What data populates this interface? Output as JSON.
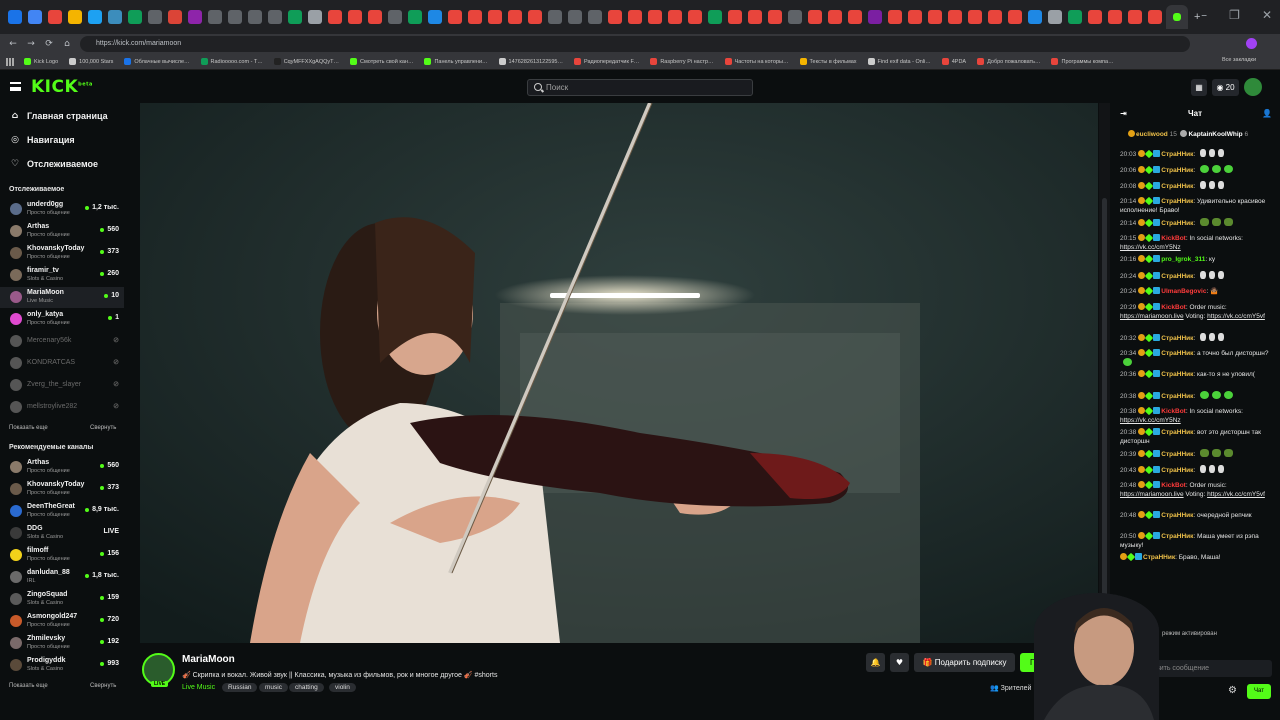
{
  "browser": {
    "url": "https://kick.com/mariamoon",
    "window_controls": [
      "–",
      "❐",
      "✕"
    ],
    "nav": {
      "back": "←",
      "forward": "→",
      "reload": "⟳",
      "home": "⌂"
    },
    "bookmarks": [
      "Kick Logo",
      "100,000 Stars",
      "Облачные вычисле…",
      "Radiooooo.com - T…",
      "CqyMFFXXgAQQyT…",
      "Смотреть свой кан…",
      "Панель управлени…",
      "1476282613122595…",
      "Радиопередатчик F…",
      "Raspberry Pi настр…",
      "Частоты на которы…",
      "Тексты в фильмах",
      "Find exif data - Onli…",
      "4PDA",
      "Добро пожаловать…",
      "Программы компа…"
    ],
    "bookmarks_right": "Все закладки"
  },
  "header": {
    "logo": "KICK",
    "logo_sup": "beta",
    "search_placeholder": "Поиск",
    "points": "20"
  },
  "sidebar": {
    "nav": [
      {
        "icon": "⌂",
        "label": "Главная страница"
      },
      {
        "icon": "◎",
        "label": "Навигация"
      },
      {
        "icon": "♡",
        "label": "Отслеживаемое"
      }
    ],
    "followed_title": "Отслеживаемое",
    "followed": [
      {
        "name": "underd0gg",
        "cat": "Просто общение",
        "viewers": "1,2 тыс.",
        "color": "#5a6c8a",
        "live": true
      },
      {
        "name": "Arthas",
        "cat": "Просто общение",
        "viewers": "560",
        "color": "#8a7a6a",
        "live": true
      },
      {
        "name": "KhovanskyToday",
        "cat": "Просто общение",
        "viewers": "373",
        "color": "#6a5a4a",
        "live": true
      },
      {
        "name": "firamir_tv",
        "cat": "Slots & Casino",
        "viewers": "260",
        "color": "#7a6a5a",
        "live": true
      },
      {
        "name": "MariaMoon",
        "cat": "Live Music",
        "viewers": "10",
        "color": "#9a5a8a",
        "live": true,
        "active": true
      },
      {
        "name": "only_katya",
        "cat": "Просто общение",
        "viewers": "1",
        "color": "#e04ad0",
        "live": true
      },
      {
        "name": "Mercenary56k",
        "cat": "",
        "viewers": "",
        "color": "#555",
        "live": false
      },
      {
        "name": "KONDRATCAS",
        "cat": "",
        "viewers": "",
        "color": "#555",
        "live": false
      },
      {
        "name": "Zverg_the_slayer",
        "cat": "",
        "viewers": "",
        "color": "#555",
        "live": false
      },
      {
        "name": "mellstroylive282",
        "cat": "",
        "viewers": "",
        "color": "#555",
        "live": false
      }
    ],
    "followed_more": "Показать еще",
    "followed_less": "Свернуть",
    "recommended_title": "Рекомендуемые каналы",
    "recommended": [
      {
        "name": "Arthas",
        "cat": "Просто общение",
        "viewers": "560",
        "color": "#8a7a6a"
      },
      {
        "name": "KhovanskyToday",
        "cat": "Просто общение",
        "viewers": "373",
        "color": "#6a5a4a"
      },
      {
        "name": "DeenTheGreat",
        "cat": "Просто общение",
        "viewers": "8,9 тыс.",
        "color": "#2a6ad0"
      },
      {
        "name": "DDG",
        "cat": "Slots & Casino",
        "viewers": "LIVE",
        "color": "#3a3a3a"
      },
      {
        "name": "filmoff",
        "cat": "Просто общение",
        "viewers": "156",
        "color": "#f2d21a"
      },
      {
        "name": "danludan_88",
        "cat": "IRL",
        "viewers": "1,8 тыс.",
        "color": "#6a6a6a"
      },
      {
        "name": "ZingoSquad",
        "cat": "Slots & Casino",
        "viewers": "159",
        "color": "#5a5a5a"
      },
      {
        "name": "Asmongold247",
        "cat": "Просто общение",
        "viewers": "720",
        "color": "#c85a2a"
      },
      {
        "name": "Zhmilevsky",
        "cat": "Просто общение",
        "viewers": "192",
        "color": "#7a6a6a"
      },
      {
        "name": "Prodigyddk",
        "cat": "Slots & Casino",
        "viewers": "993",
        "color": "#5a4a3a"
      }
    ],
    "rec_more": "Показать еще",
    "rec_less": "Свернуть"
  },
  "stream": {
    "name": "MariaMoon",
    "live_badge": "LIVE",
    "title": "🎻 Скрипка и вокал. Живой звук || Классика, музыка из фильмов, рок и многое другое 🎻 #shorts",
    "category": "Live Music",
    "tags": [
      "Russian",
      "music",
      "chatting",
      "violin"
    ],
    "bell": "🔔",
    "heart": "♥",
    "gift_sub": "Подарить подписку",
    "subscribe": "Подписка",
    "viewers_label": "Зрителей"
  },
  "chat": {
    "title": "Чат",
    "pinned": [
      {
        "name": "eucliwood",
        "count": "15"
      },
      {
        "name": "KaptainKoolWhip",
        "count": "6"
      }
    ],
    "messages": [
      {
        "time": "20:03",
        "user": "СтраННик",
        "text": "",
        "emotes": [
          "w",
          "w",
          "w"
        ],
        "ucls": "u-y"
      },
      {
        "time": "20:06",
        "user": "СтраННик",
        "text": "",
        "emotes": [
          "gr",
          "gr",
          "gr"
        ],
        "ucls": "u-y"
      },
      {
        "time": "20:08",
        "user": "СтраННик",
        "text": "",
        "emotes": [
          "w",
          "w",
          "w"
        ],
        "ucls": "u-y"
      },
      {
        "time": "20:14",
        "user": "СтраННик",
        "text": "Удивительно красивое исполнение! Браво!",
        "emotes": [],
        "ucls": "u-y"
      },
      {
        "time": "20:14",
        "user": "СтраННик",
        "text": "",
        "emotes": [
          "fr",
          "fr",
          "fr"
        ],
        "ucls": "u-y"
      },
      {
        "time": "20:15",
        "user": "KickBot",
        "text": "In social networks: ",
        "link": "https://vk.cc/cmY5Nz",
        "emotes": [],
        "ucls": "u-r"
      },
      {
        "time": "20:16",
        "user": "pro_Igrok_311",
        "text": "ку",
        "emotes": [],
        "ucls": "u-g"
      },
      {
        "time": "20:24",
        "user": "СтраННик",
        "text": "",
        "emotes": [
          "w",
          "w",
          "w"
        ],
        "ucls": "u-y"
      },
      {
        "time": "20:24",
        "user": "UlmanBegovic",
        "text": "🤷🏽",
        "emotes": [],
        "ucls": "u-r"
      },
      {
        "time": "20:29",
        "user": "KickBot",
        "text": "Order music: ",
        "link": "https://mariamoon.live",
        "text2": " Voting: ",
        "link2": "https://vk.cc/cmY5vf",
        "emotes": [],
        "ucls": "u-r"
      },
      {
        "time": "20:32",
        "user": "СтраННик",
        "text": "",
        "emotes": [
          "w",
          "w",
          "w"
        ],
        "ucls": "u-y"
      },
      {
        "time": "20:34",
        "user": "СтраННик",
        "text": "а точно был дисторшн?",
        "emotes": [
          "gr"
        ],
        "ucls": "u-y"
      },
      {
        "time": "20:36",
        "user": "СтраННик",
        "text": "как-то я не уловил(",
        "emotes": [],
        "ucls": "u-y"
      },
      {
        "time": "20:38",
        "user": "СтраННик",
        "text": "",
        "emotes": [
          "gr",
          "gr",
          "gr"
        ],
        "ucls": "u-y"
      },
      {
        "time": "20:38",
        "user": "KickBot",
        "text": "In social networks: ",
        "link": "https://vk.cc/cmY5Nz",
        "emotes": [],
        "ucls": "u-r"
      },
      {
        "time": "20:38",
        "user": "СтраННик",
        "text": "вот это дисторшн так дисторшн",
        "emotes": [],
        "ucls": "u-y"
      },
      {
        "time": "20:39",
        "user": "СтраННик",
        "text": "",
        "emotes": [
          "fr",
          "fr",
          "fr"
        ],
        "ucls": "u-y"
      },
      {
        "time": "20:43",
        "user": "СтраННик",
        "text": "",
        "emotes": [
          "w",
          "w",
          "w"
        ],
        "ucls": "u-y"
      },
      {
        "time": "20:48",
        "user": "KickBot",
        "text": "Order music: ",
        "link": "https://mariamoon.live",
        "text2": " Voting: ",
        "link2": "https://vk.cc/cmY5vf",
        "emotes": [],
        "ucls": "u-r"
      },
      {
        "time": "20:48",
        "user": "СтраННик",
        "text": "очередной репчик",
        "emotes": [],
        "ucls": "u-y"
      },
      {
        "time": "20:50",
        "user": "СтраННик",
        "text": "Маша умеет из рэпа музыку!",
        "emotes": [],
        "ucls": "u-y"
      },
      {
        "time": "",
        "user": "СтраННик",
        "text": "Браво, Маша!",
        "emotes": [],
        "ucls": "u-y"
      }
    ],
    "slow_mode": "режим активирован",
    "input_placeholder": "вить сообщение",
    "send": "Чат"
  }
}
